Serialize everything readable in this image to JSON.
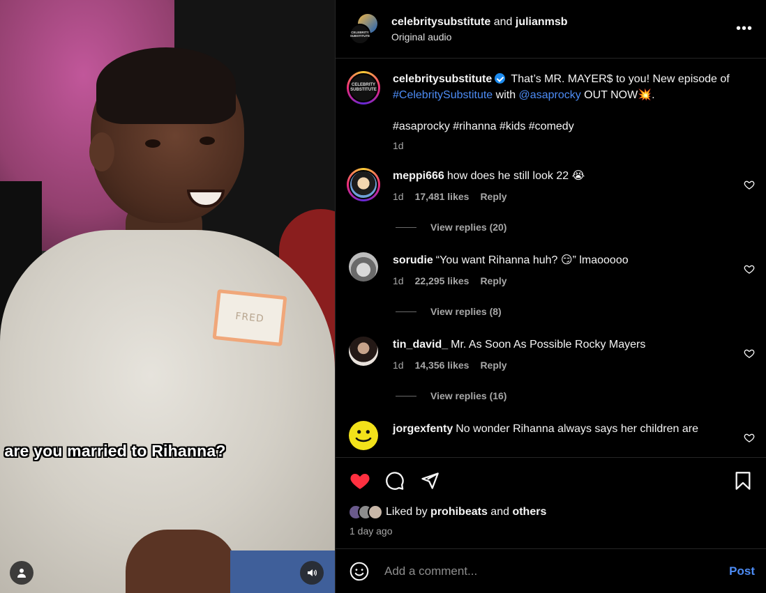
{
  "video": {
    "subtitle": "are you married to Rihanna?",
    "name_tag": "FRED"
  },
  "header": {
    "user1": "celebritysubstitute",
    "joiner": "and",
    "user2": "julianmsb",
    "audio": "Original audio",
    "avatar_text": "CELEBRITY SUBSTITUTE",
    "more": "•••"
  },
  "caption": {
    "user": "celebritysubstitute",
    "text_a": "That’s MR. MAYER$ to you! New episode of",
    "tag1": "#CelebritySubstitute",
    "text_b": "with",
    "mention": "@asaprocky",
    "text_c": "OUT NOW💥.",
    "hashtags": "#asaprocky #rihanna #kids #comedy",
    "time": "1d",
    "avatar_text": "CELEBRITY SUBSTITUTE"
  },
  "comments": [
    {
      "user": "meppi666",
      "text": "how does he still look 22 😭",
      "time": "1d",
      "likes": "17,481 likes",
      "reply": "Reply",
      "view_replies": "View replies (20)"
    },
    {
      "user": "sorudie",
      "text": "“You want Rihanna huh? 😏” lmaooooo",
      "time": "1d",
      "likes": "22,295 likes",
      "reply": "Reply",
      "view_replies": "View replies (8)"
    },
    {
      "user": "tin_david_",
      "text": "Mr. As Soon As Possible Rocky Mayers",
      "time": "1d",
      "likes": "14,356 likes",
      "reply": "Reply",
      "view_replies": "View replies (16)"
    },
    {
      "user": "jorgexfenty",
      "text": "No wonder Rihanna always says her children are"
    }
  ],
  "likes": {
    "prefix": "Liked by",
    "user": "prohibeats",
    "joiner": "and",
    "others": "others",
    "time_ago": "1 day ago"
  },
  "add_comment": {
    "placeholder": "Add a comment...",
    "post": "Post"
  },
  "colors": {
    "accent": "#4d8cf5",
    "heart": "#ff3040",
    "verified": "#1d8cf0"
  }
}
